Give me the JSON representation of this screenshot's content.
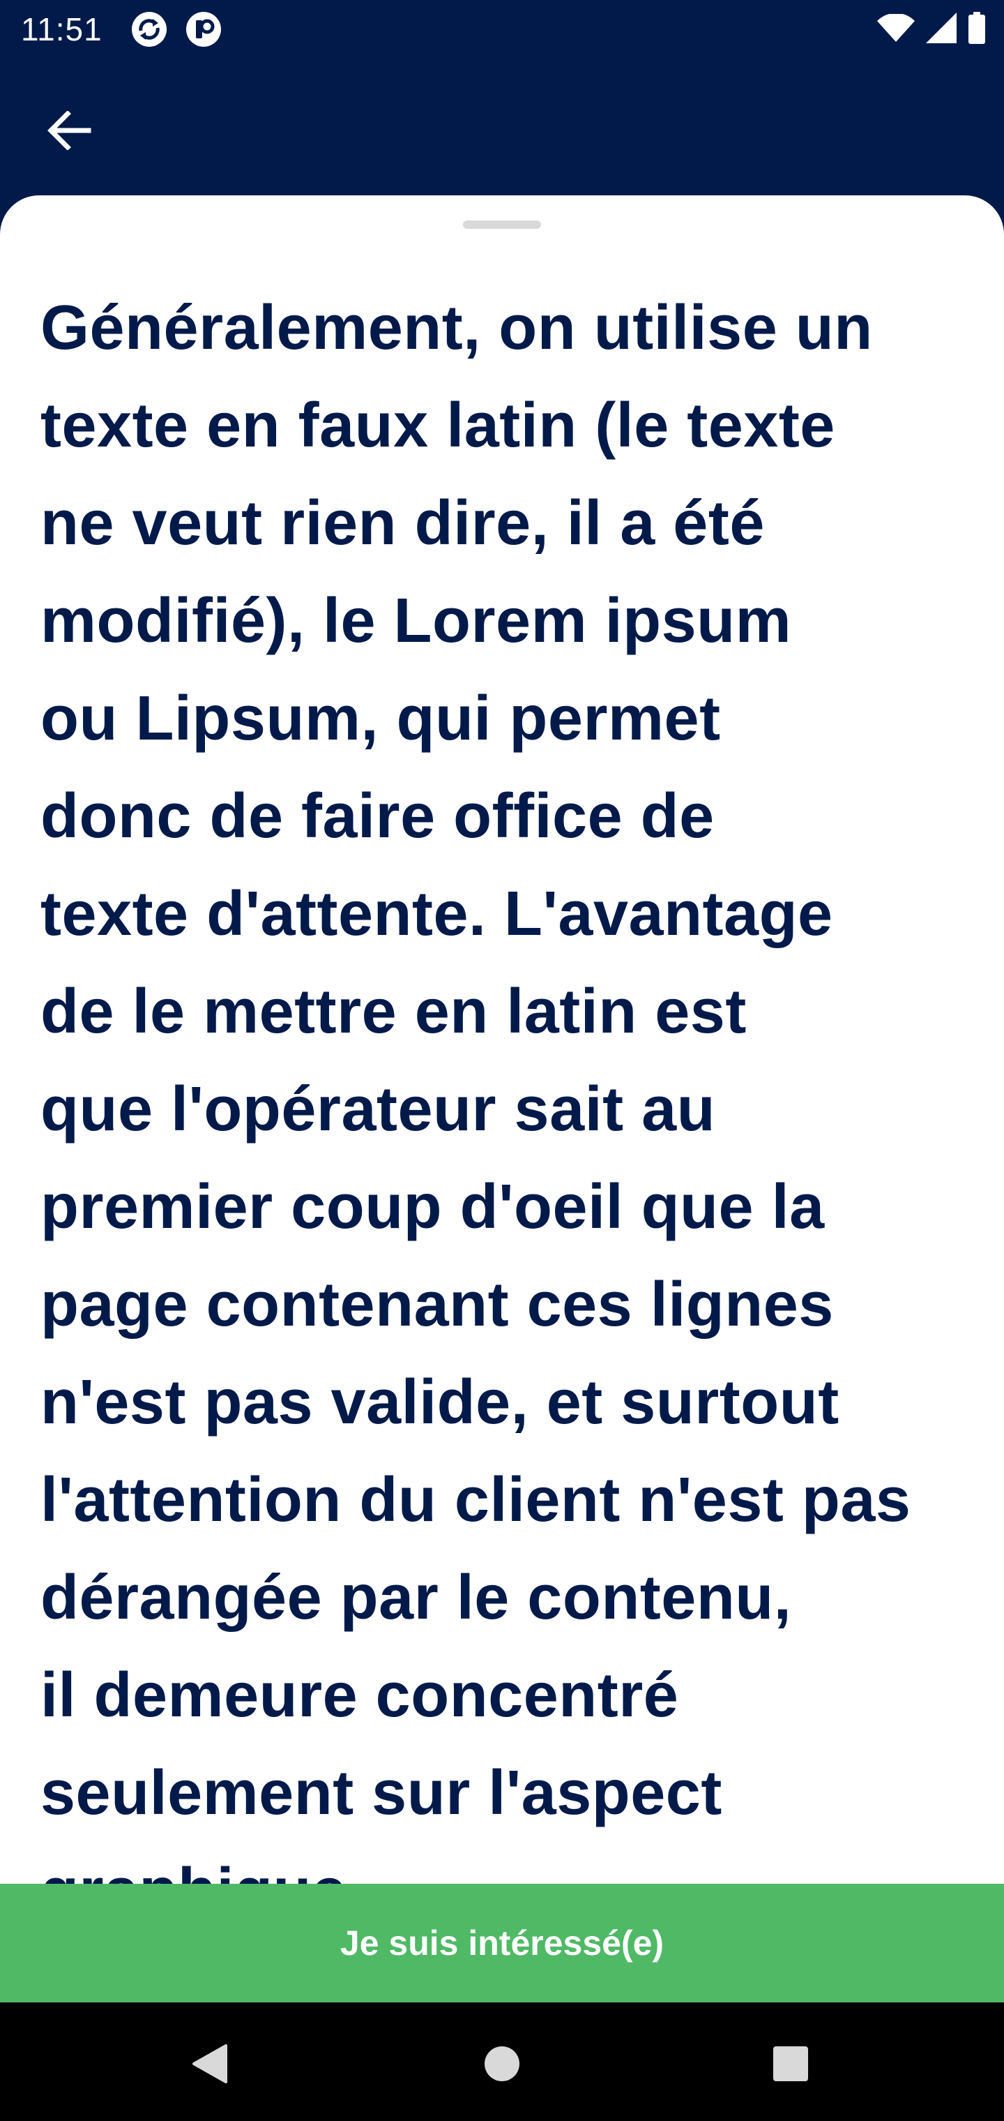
{
  "status_bar": {
    "time": "11:51",
    "icons": [
      "sync-app-icon",
      "notification-app-icon",
      "wifi-icon",
      "cellular-signal-icon",
      "battery-icon"
    ]
  },
  "app_bar": {
    "back_icon": "arrow-left-icon"
  },
  "content": {
    "lines": [
      "Généralement, on utilise un",
      "texte en faux latin (le texte",
      "ne veut rien dire, il a été",
      "modifié), le Lorem ipsum",
      "ou Lipsum, qui permet",
      "donc de faire office de",
      "texte d'attente. L'avantage",
      "de le mettre en latin est",
      "que l'opérateur sait au",
      "premier coup d'oeil que la",
      "page contenant ces lignes",
      "n'est pas valide, et surtout",
      "l'attention du client n'est pas",
      "dérangée par le contenu,",
      "il demeure concentré",
      "seulement sur l'aspect",
      "graphique."
    ]
  },
  "cta": {
    "label": "Je suis intéressé(e)"
  },
  "nav_bar": {
    "icons": [
      "nav-back-icon",
      "nav-home-icon",
      "nav-recents-icon"
    ]
  },
  "colors": {
    "primary_dark": "#021a4a",
    "accent_green": "#4fb966",
    "sheet_bg": "#ffffff",
    "nav_bg": "#000000"
  }
}
